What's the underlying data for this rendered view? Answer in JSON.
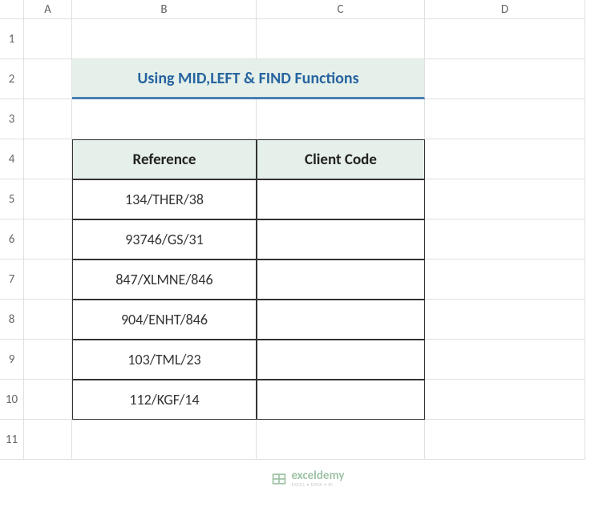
{
  "columns": [
    "A",
    "B",
    "C",
    "D"
  ],
  "rows": [
    "1",
    "2",
    "3",
    "4",
    "5",
    "6",
    "7",
    "8",
    "9",
    "10",
    "11"
  ],
  "title": "Using MID,LEFT & FIND Functions",
  "table": {
    "headers": [
      "Reference",
      "Client Code"
    ],
    "data": [
      {
        "reference": "134/THER/38",
        "client_code": ""
      },
      {
        "reference": "93746/GS/31",
        "client_code": ""
      },
      {
        "reference": "847/XLMNE/846",
        "client_code": ""
      },
      {
        "reference": "904/ENHT/846",
        "client_code": ""
      },
      {
        "reference": "103/TML/23",
        "client_code": ""
      },
      {
        "reference": "112/KGF/14",
        "client_code": ""
      }
    ]
  },
  "watermark": {
    "brand": "exceldemy",
    "tagline": "EXCEL • DATA • BI"
  }
}
